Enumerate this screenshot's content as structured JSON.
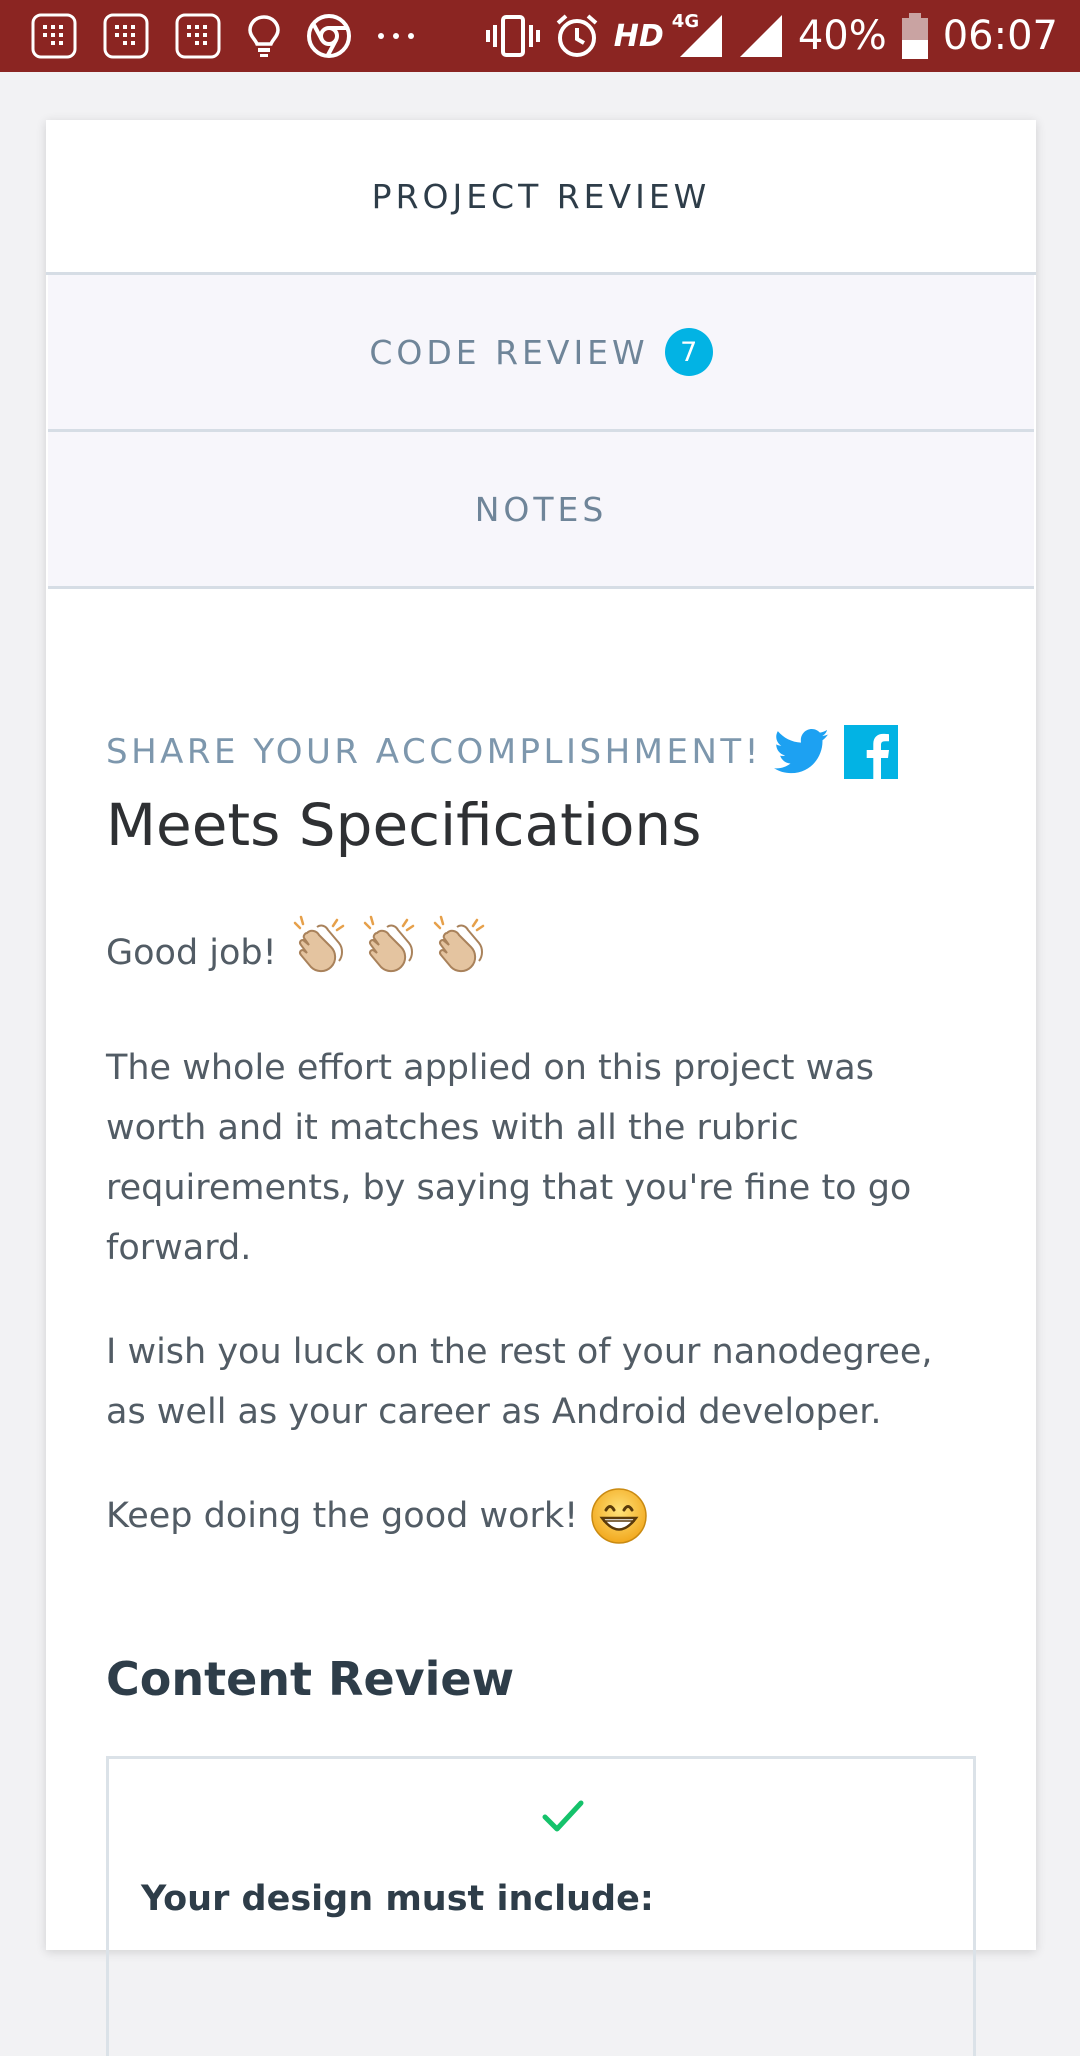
{
  "status_bar": {
    "battery_percent": "40%",
    "time": "06:07",
    "network_label": "HD",
    "network_type": "4G",
    "background_color": "#8b2522",
    "left_icons": [
      "calendar-icon",
      "calendar-icon",
      "calendar-icon",
      "lightbulb-icon",
      "chrome-icon",
      "more-dots-icon"
    ],
    "right_icons": [
      "vibrate-icon",
      "alarm-icon",
      "signal-icon",
      "signal-icon",
      "battery-icon"
    ]
  },
  "tabs": [
    {
      "label": "PROJECT REVIEW",
      "active": true
    },
    {
      "label": "CODE REVIEW",
      "badge": "7",
      "active": false
    },
    {
      "label": "NOTES",
      "active": false
    }
  ],
  "share": {
    "label": "SHARE YOUR ACCOMPLISHMENT!",
    "icons": [
      "twitter-icon",
      "facebook-icon"
    ]
  },
  "review": {
    "result_title": "Meets Specifications",
    "paragraph_1": "Good job!",
    "paragraph_2": "The whole effort applied on this project was worth and it matches with all the rubric requirements, by saying that you're fine to go forward.",
    "paragraph_3": "I wish you luck on the rest of your nanodegree, as well as your career as Android developer.",
    "paragraph_4": "Keep doing the good work!",
    "emojis": [
      "clapping-hands-emoji",
      "clapping-hands-emoji",
      "clapping-hands-emoji",
      "grinning-face-emoji"
    ]
  },
  "content_review": {
    "heading": "Content Review",
    "items": [
      {
        "status_icon": "check-icon",
        "text": "Your design must include:"
      }
    ]
  },
  "colors": {
    "accent": "#02b3e4",
    "success": "#15c26b",
    "twitter": "#1da1f2",
    "facebook": "#02b3e4",
    "muted_text": "#7d97ad"
  }
}
